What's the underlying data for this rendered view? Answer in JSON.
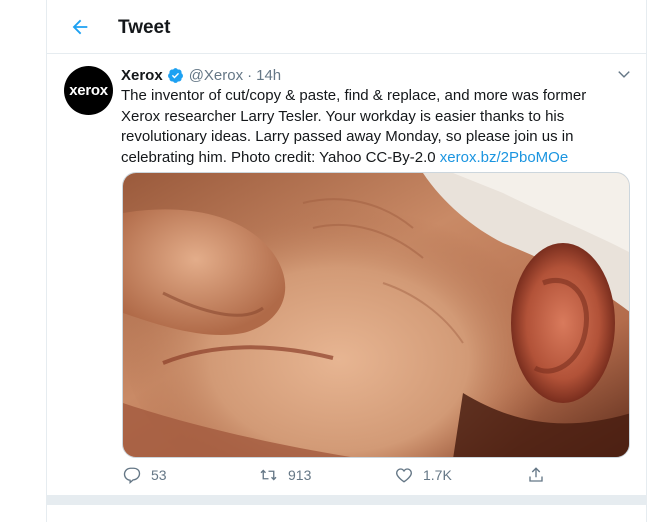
{
  "header": {
    "title": "Tweet",
    "back_icon": "arrow-left-icon",
    "accent": "#1da1f2"
  },
  "tweet": {
    "avatar_text": "xerox",
    "display_name": "Xerox",
    "verified_icon": "verified-badge-icon",
    "handle": "@Xerox",
    "separator": "·",
    "time": "14h",
    "menu_icon": "chevron-down-icon",
    "text": "The inventor of cut/copy & paste, find & replace, and more was former Xerox researcher Larry Tesler. Your workday is easier thanks to his revolutionary ideas. Larry passed away Monday, so please join us in celebrating him. Photo credit: Yahoo CC-By-2.0 ",
    "link_text": "xerox.bz/2PboMOe",
    "link_color": "#1b95e0",
    "media_description_icon": "photo-close-up-face"
  },
  "actions": {
    "reply": {
      "icon": "reply-icon",
      "count": "53"
    },
    "retweet": {
      "icon": "retweet-icon",
      "count": "913"
    },
    "like": {
      "icon": "heart-icon",
      "count": "1.7K"
    },
    "share": {
      "icon": "share-icon"
    }
  },
  "colors": {
    "text": "#14171a",
    "muted": "#657786",
    "border": "#e6ecf0"
  }
}
